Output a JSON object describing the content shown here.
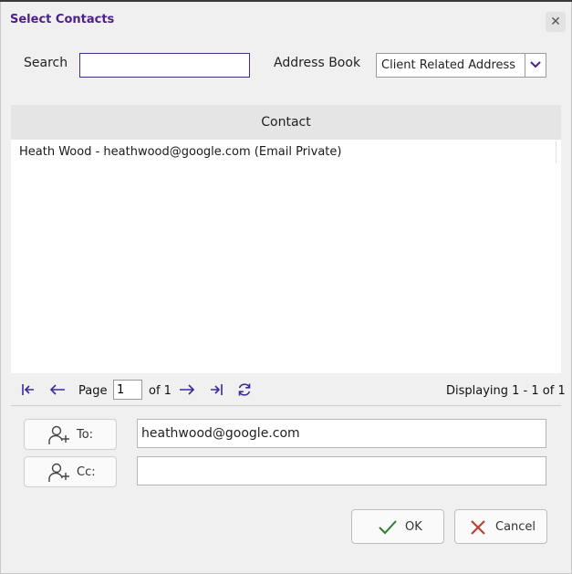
{
  "dialog": {
    "title": "Select Contacts",
    "close_symbol": "✕"
  },
  "search": {
    "label": "Search",
    "value": ""
  },
  "address_book": {
    "label": "Address Book",
    "selected": "Client Related Address"
  },
  "grid": {
    "column_header": "Contact",
    "rows": [
      "Heath Wood - heathwood@google.com (Email Private)"
    ]
  },
  "pager": {
    "page_label": "Page",
    "page_value": "1",
    "of_label": "of 1",
    "displaying": "Displaying 1 - 1 of 1"
  },
  "recipients": {
    "to_label": "To:",
    "to_value": "heathwood@google.com",
    "cc_label": "Cc:",
    "cc_value": ""
  },
  "actions": {
    "ok_label": "OK",
    "cancel_label": "Cancel"
  },
  "colors": {
    "accent": "#4b1f8c",
    "ok_icon": "#2e7d32",
    "cancel_icon": "#c0392b"
  },
  "icons": {
    "first": "first-page-icon",
    "prev": "prev-page-icon",
    "next": "next-page-icon",
    "last": "last-page-icon",
    "refresh": "refresh-icon",
    "add_person": "add-person-icon",
    "dropdown": "chevron-down-icon",
    "ok": "checkmark-icon",
    "cancel": "x-icon"
  }
}
